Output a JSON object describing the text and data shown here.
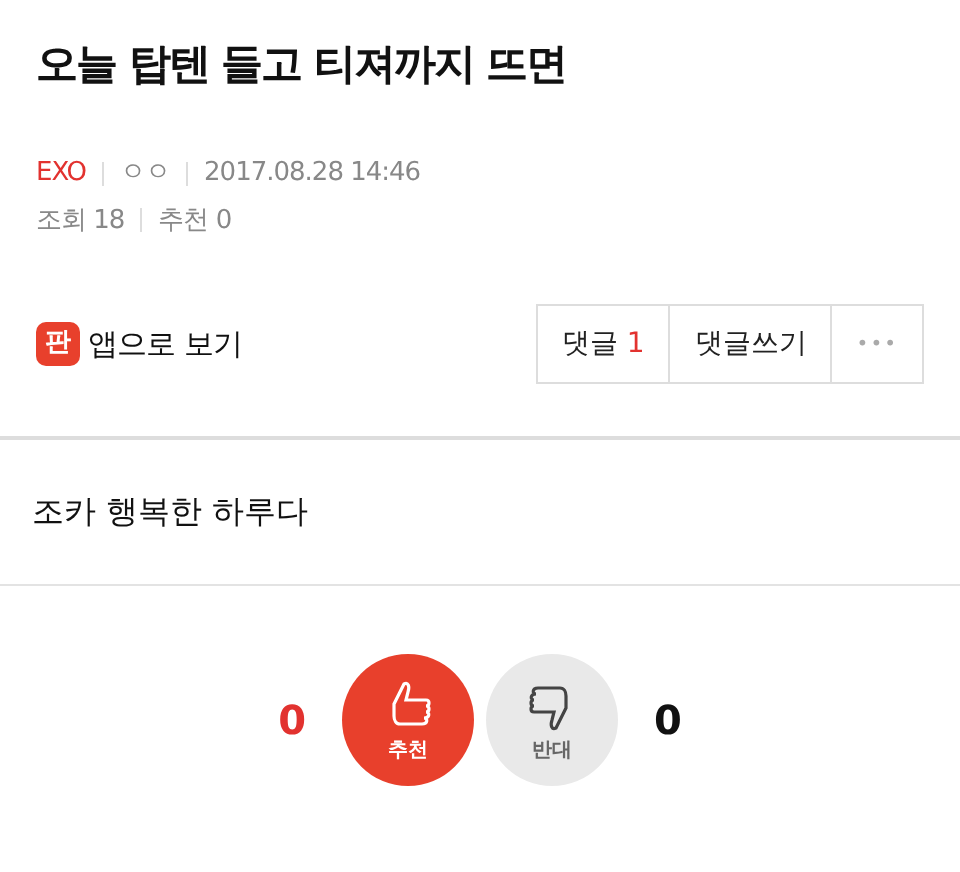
{
  "title": "오늘 탑텐 들고 티져까지 뜨면",
  "meta": {
    "category": "EXO",
    "author": "ㅇㅇ",
    "date": "2017.08.28 14:46",
    "views_label": "조회",
    "views": "18",
    "recommend_label": "추천",
    "recommend": "0"
  },
  "app_link": {
    "icon_text": "판",
    "label": "앱으로 보기"
  },
  "actions": [
    {
      "kind": "comments",
      "label": "댓글",
      "count": "1"
    },
    {
      "kind": "write",
      "label": "댓글쓰기"
    },
    {
      "kind": "more",
      "label": "•••"
    }
  ],
  "body": "조카 행복한 하루다",
  "votes": {
    "up_count": "0",
    "up_label": "추천",
    "down_label": "반대",
    "down_count": "0"
  }
}
